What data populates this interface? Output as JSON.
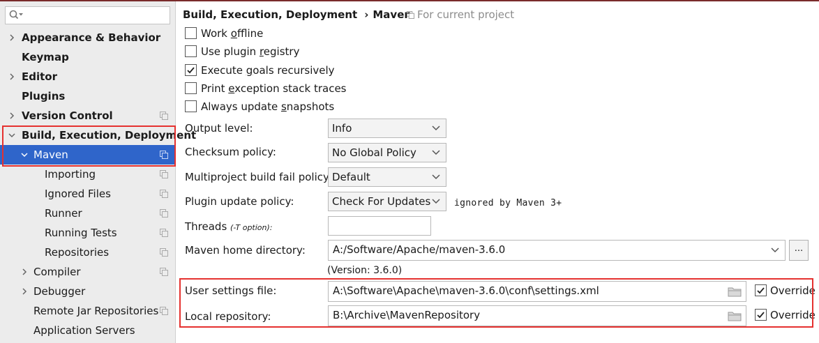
{
  "search": {
    "placeholder": ""
  },
  "sidebar": {
    "items": [
      {
        "label": "Appearance & Behavior"
      },
      {
        "label": "Keymap"
      },
      {
        "label": "Editor"
      },
      {
        "label": "Plugins"
      },
      {
        "label": "Version Control"
      },
      {
        "label": "Build, Execution, Deployment"
      },
      {
        "label": "Maven"
      },
      {
        "label": "Importing"
      },
      {
        "label": "Ignored Files"
      },
      {
        "label": "Runner"
      },
      {
        "label": "Running Tests"
      },
      {
        "label": "Repositories"
      },
      {
        "label": "Compiler"
      },
      {
        "label": "Debugger"
      },
      {
        "label": "Remote Jar Repositories"
      },
      {
        "label": "Application Servers"
      }
    ]
  },
  "header": {
    "breadcrumb": [
      "Build, Execution, Deployment",
      "Maven"
    ],
    "separator": "›",
    "scope": "For current project"
  },
  "options": {
    "work_offline": {
      "pre": "Work ",
      "accel": "o",
      "post": "ffline",
      "checked": false
    },
    "plugin_registry": {
      "pre": "Use plugin ",
      "accel": "r",
      "post": "egistry",
      "checked": false
    },
    "execute_goals": {
      "pre": "Execute ",
      "accel": "g",
      "post": "oals recursively",
      "checked": true
    },
    "print_traces": {
      "pre": "Print ",
      "accel": "e",
      "post": "xception stack traces",
      "checked": false
    },
    "update_snapshots": {
      "pre": "Always update ",
      "accel": "s",
      "post": "napshots",
      "checked": false
    }
  },
  "form": {
    "output_level": {
      "label": "Output level:",
      "value": "Info"
    },
    "checksum_policy": {
      "label": "Checksum policy:",
      "value": "No Global Policy"
    },
    "multiproject_policy": {
      "label": "Multiproject build fail policy:",
      "value": "Default"
    },
    "plugin_update_policy": {
      "label": "Plugin update policy:",
      "value": "Check For Updates",
      "note": "ignored by Maven 3+"
    },
    "threads": {
      "label": "Threads ",
      "hint": "(-T option):",
      "value": ""
    },
    "maven_home": {
      "label": "Maven home directory:",
      "value": "A:/Software/Apache/maven-3.6.0",
      "browse": "...",
      "version": "(Version: 3.6.0)"
    },
    "user_settings": {
      "label": "User settings file:",
      "value": "A:\\Software\\Apache\\maven-3.6.0\\conf\\settings.xml",
      "override_label": "Override",
      "override_checked": true
    },
    "local_repository": {
      "label": "Local repository:",
      "value": "B:\\Archive\\MavenRepository",
      "override_label": "Override",
      "override_checked": true
    }
  },
  "colors": {
    "selection": "#2f65ca",
    "highlight_box": "#e5312f",
    "sidebar_bg": "#ececec"
  }
}
